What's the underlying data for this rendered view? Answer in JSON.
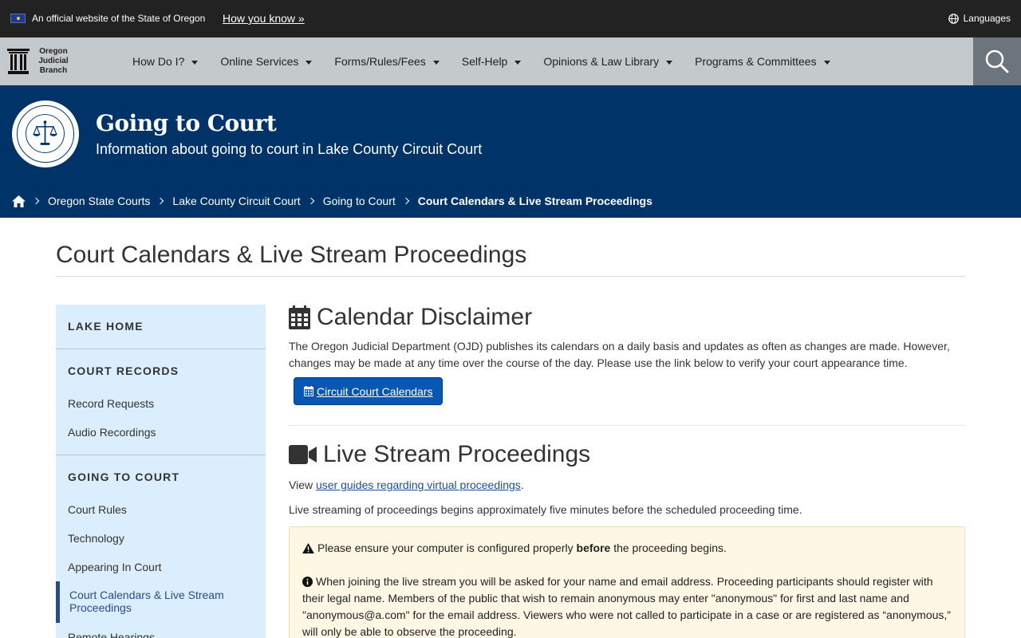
{
  "official_bar": {
    "text": "An official website of the State of Oregon",
    "how_link": "How you know »",
    "languages": "Languages"
  },
  "logo": {
    "line1": "Oregon",
    "line2": "Judicial",
    "line3": "Branch"
  },
  "nav": {
    "items": [
      {
        "label": "How Do I?"
      },
      {
        "label": "Online Services"
      },
      {
        "label": "Forms/Rules/Fees"
      },
      {
        "label": "Self-Help"
      },
      {
        "label": "Opinions & Law Library"
      },
      {
        "label": "Programs & Committees"
      }
    ]
  },
  "banner": {
    "title": "Going to Court",
    "subtitle": "Information about going to court in Lake County Circuit Court"
  },
  "breadcrumb": {
    "items": [
      "Oregon State Courts",
      "Lake County Circuit Court",
      "Going to Court"
    ],
    "current": "Court Calendars & Live Stream Proceedings"
  },
  "page": {
    "title": "Court Calendars & Live Stream Proceedings"
  },
  "sidebar": {
    "lake_home": "LAKE HOME",
    "court_records": "COURT RECORDS",
    "record_requests": "Record Requests",
    "audio_recordings": "Audio Recordings",
    "going_to_court": "GOING TO COURT",
    "court_rules": "Court Rules",
    "technology": "Technology",
    "appearing_in_court": "Appearing In Court",
    "active": "Court Calendars & Live Stream Proceedings",
    "remote_hearings": "Remote Hearings"
  },
  "calendar_section": {
    "heading": "Calendar Disclaimer",
    "text": "The Oregon Judicial Department (OJD) publishes its calendars on a daily basis and updates as often as changes are made. However, changes may be made at any time over the course of the day. Please use the link below to verify your court appearance time.",
    "button": "Circuit Court Calendars"
  },
  "live_section": {
    "heading": "Live Stream Proceedings",
    "view_prefix": "View ",
    "view_link": "user guides regarding virtual proceedings",
    "view_suffix": ".",
    "timing": "Live streaming of proceedings begins approximately five minutes before the scheduled proceeding time.",
    "notice_1_pre": "Please ensure your computer is configured properly ",
    "notice_1_bold": "before",
    "notice_1_post": " the proceeding begins.",
    "notice_2": "When joining the live stream you will be asked for your name and email address. Proceeding participants should register with their legal name. Members of the public that wish to remain anonymous may enter \"anonymous\" for first and last name and \"anonymous@a.com\" for the email address. Viewers who were not called to participate in a case or are registered as “anonymous,” will only be able to observe the proceeding."
  },
  "colors": {
    "banner_bg": "#003469",
    "nav_bg": "#c4c9cc",
    "sidebar_bg": "#dbeefd",
    "button_bg": "#0a56b3",
    "notice_bg": "#fdf7e4"
  }
}
